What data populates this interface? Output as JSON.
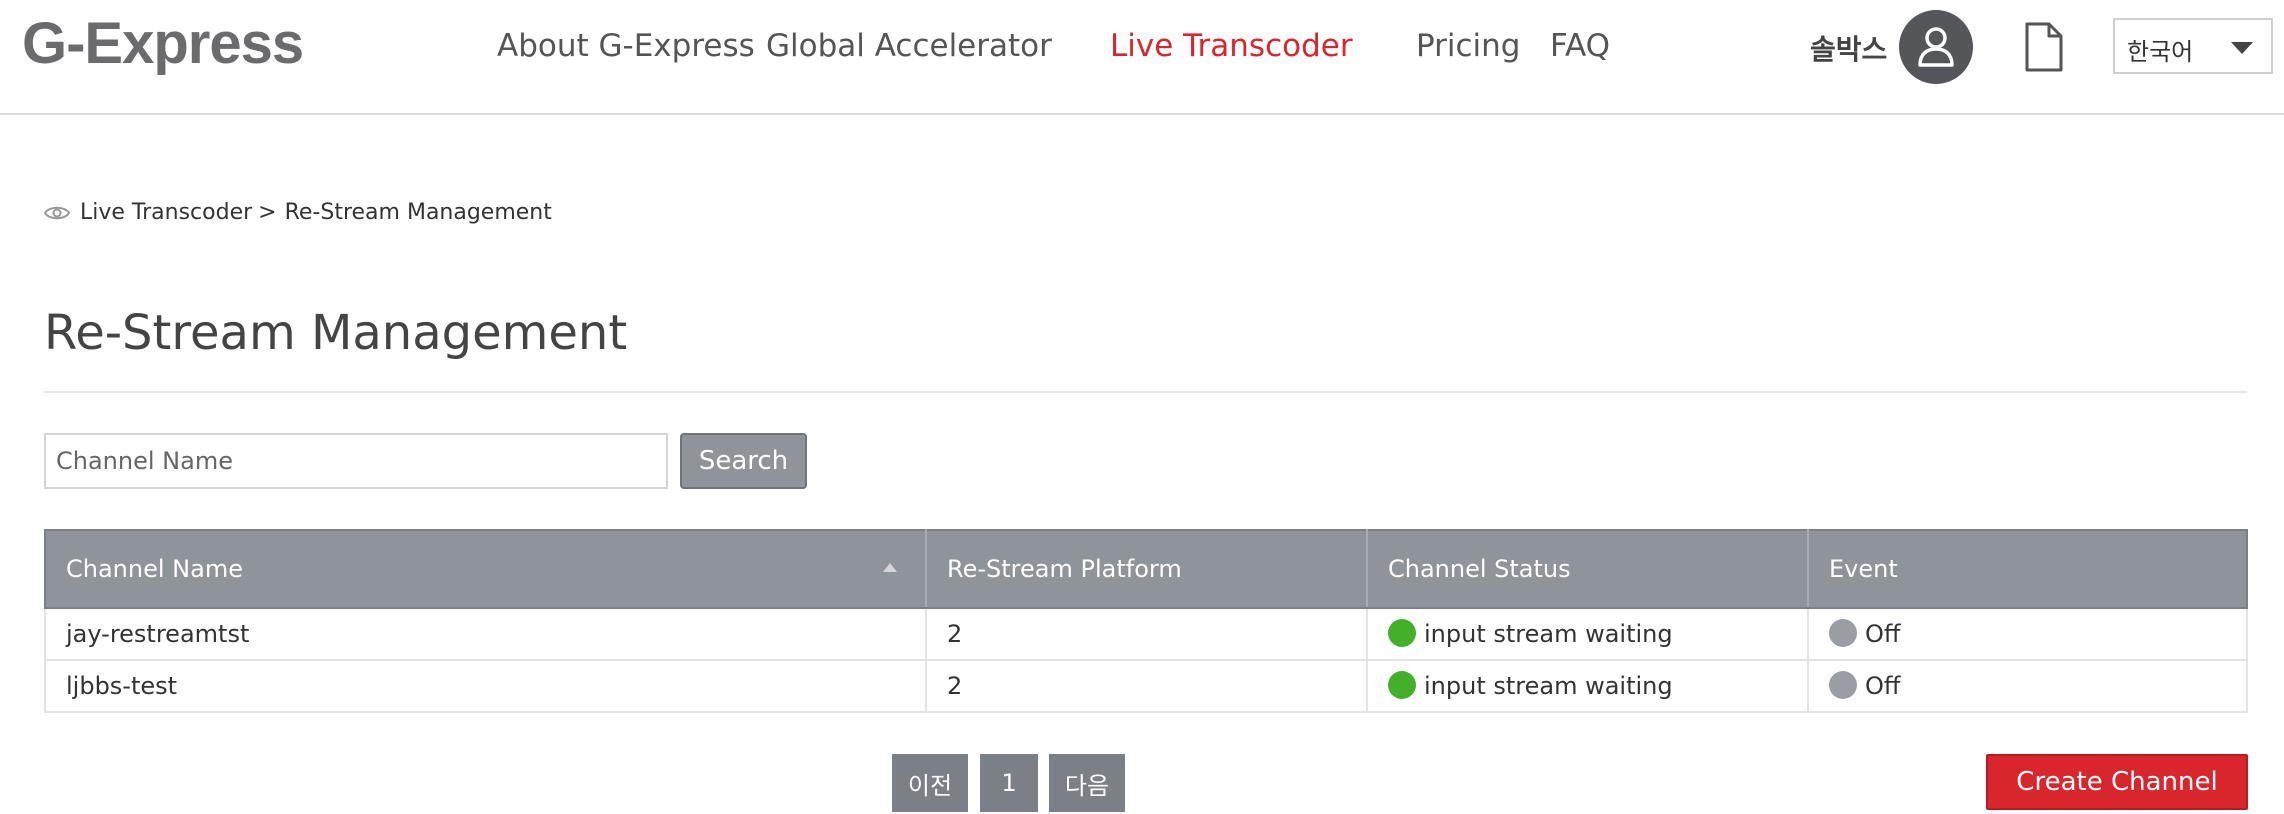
{
  "header": {
    "logo": "G-Express",
    "nav": [
      {
        "label": "About G-Express"
      },
      {
        "label": "Global Accelerator"
      },
      {
        "label": "Live Transcoder",
        "active": true
      },
      {
        "label": "Pricing"
      },
      {
        "label": "FAQ"
      }
    ],
    "user_name": "솔박스",
    "language": "한국어"
  },
  "breadcrumb": {
    "parent": "Live Transcoder",
    "separator": ">",
    "current": "Re-Stream Management"
  },
  "page_title": "Re-Stream Management",
  "search": {
    "placeholder": "Channel Name",
    "value": "",
    "button_label": "Search"
  },
  "table": {
    "columns": [
      "Channel Name",
      "Re-Stream Platform",
      "Channel Status",
      "Event"
    ],
    "rows": [
      {
        "channel_name": "jay-restreamtst",
        "platform": "2",
        "status": "input stream waiting",
        "event": "Off"
      },
      {
        "channel_name": "ljbbs-test",
        "platform": "2",
        "status": "input stream waiting",
        "event": "Off"
      }
    ]
  },
  "pagination": {
    "prev_label": "이전",
    "current_page": "1",
    "next_label": "다음"
  },
  "create_button_label": "Create Channel",
  "colors": {
    "accent": "#d9262d",
    "header_gray": "#8f949b",
    "status_green": "#43b02a",
    "status_off": "#9a9ea4"
  }
}
